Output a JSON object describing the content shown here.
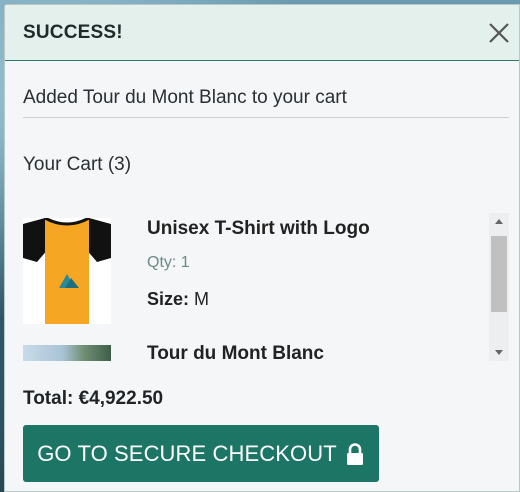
{
  "modal": {
    "title": "SUCCESS!",
    "message": "Added Tour du Mont Blanc to your cart",
    "close_icon": "close-icon"
  },
  "cart": {
    "heading": "Your Cart (3)",
    "items": [
      {
        "name": "Unisex T-Shirt with Logo",
        "qty": "Qty: 1",
        "size_label": "Size:",
        "size_value": "M",
        "thumb": "tshirt-image"
      },
      {
        "name": "Tour du Mont Blanc",
        "thumb": "mountain-photo"
      }
    ],
    "total": "Total: €4,922.50",
    "checkout_label": "GO TO SECURE CHECKOUT",
    "checkout_icon": "lock-icon"
  },
  "colors": {
    "accent": "#1d7566",
    "header_bg": "#e4f0ec",
    "tshirt_body": "#f5a623",
    "tshirt_sleeves": "#111111"
  }
}
